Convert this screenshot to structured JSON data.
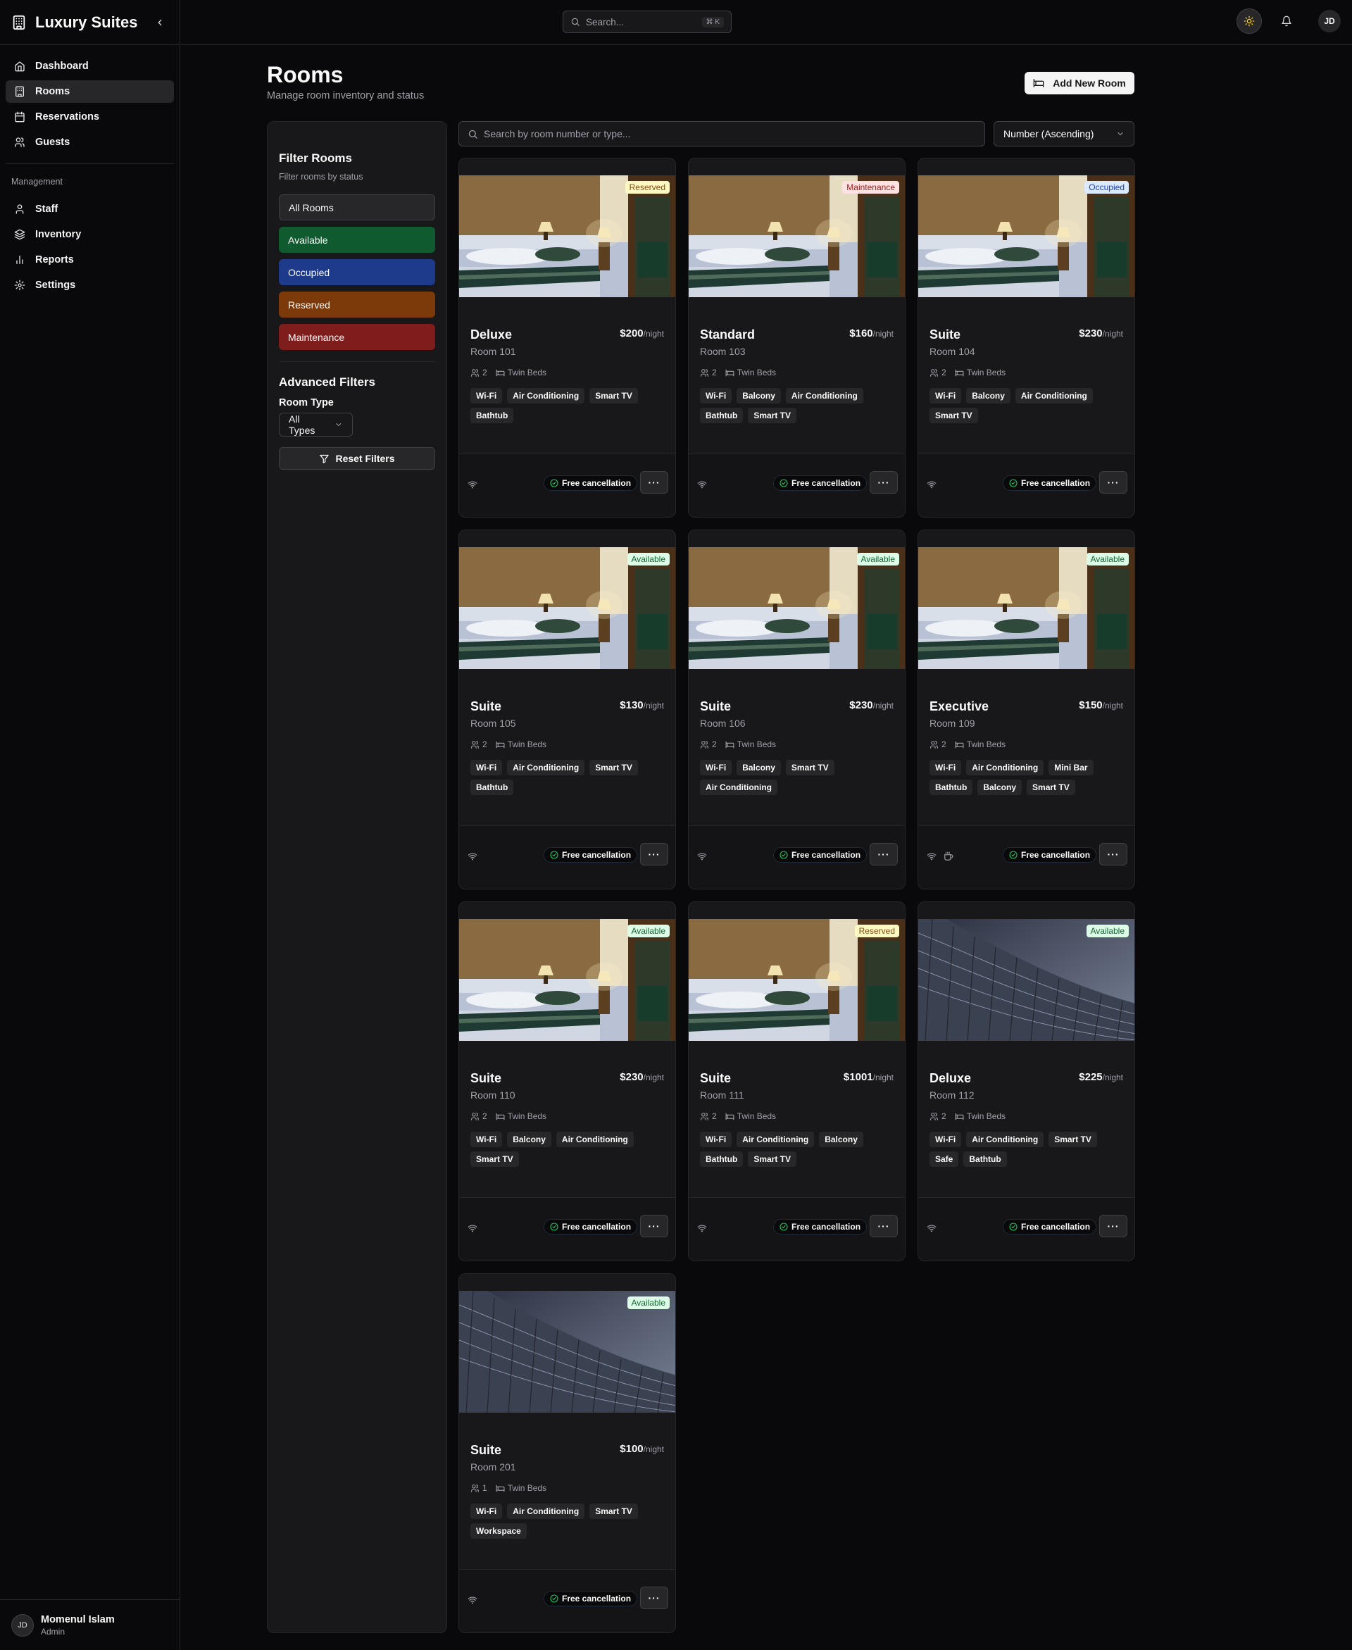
{
  "app": {
    "name": "Luxury Suites"
  },
  "sidebar": {
    "items": [
      {
        "label": "Dashboard",
        "icon": "home-icon",
        "active": false
      },
      {
        "label": "Rooms",
        "icon": "building-icon",
        "active": true
      },
      {
        "label": "Reservations",
        "icon": "calendar-icon",
        "active": false
      },
      {
        "label": "Guests",
        "icon": "users-icon",
        "active": false
      }
    ],
    "group_label": "Management",
    "mgmt_items": [
      {
        "label": "Staff",
        "icon": "user-icon"
      },
      {
        "label": "Inventory",
        "icon": "layers-icon"
      },
      {
        "label": "Reports",
        "icon": "bar-chart-icon"
      },
      {
        "label": "Settings",
        "icon": "gear-icon"
      }
    ],
    "user": {
      "initials": "JD",
      "name": "Momenul Islam",
      "role": "Admin"
    }
  },
  "topbar": {
    "search_placeholder": "Search...",
    "shortcut": "⌘ K",
    "avatar": "JD"
  },
  "page": {
    "title": "Rooms",
    "subtitle": "Manage room inventory and status",
    "add_button": "Add New Room"
  },
  "filters": {
    "title": "Filter Rooms",
    "subtitle": "Filter rooms by status",
    "status_buttons": [
      {
        "label": "All Rooms",
        "color": "#27272a"
      },
      {
        "label": "Available",
        "color": "#0f5a2e"
      },
      {
        "label": "Occupied",
        "color": "#1e3a8a"
      },
      {
        "label": "Reserved",
        "color": "#7c3a0b"
      },
      {
        "label": "Maintenance",
        "color": "#7f1d1d"
      }
    ],
    "advanced_title": "Advanced Filters",
    "room_type_label": "Room Type",
    "room_type_value": "All Types",
    "reset_label": "Reset Filters"
  },
  "search": {
    "placeholder": "Search by room number or type..."
  },
  "sort": {
    "value": "Number (Ascending)"
  },
  "common": {
    "per_night": "/night",
    "beds": "Twin Beds",
    "free_cancel": "Free cancellation",
    "more": "···"
  },
  "rooms": [
    {
      "type": "Deluxe",
      "room": "Room 101",
      "price": "$200",
      "guests": "2",
      "status": "Reserved",
      "image": "bedroom",
      "amenities": [
        "Wi-Fi",
        "Air Conditioning",
        "Smart TV",
        "Bathtub"
      ],
      "extra_icons": [
        "wifi-icon"
      ]
    },
    {
      "type": "Standard",
      "room": "Room 103",
      "price": "$160",
      "guests": "2",
      "status": "Maintenance",
      "image": "bedroom",
      "amenities": [
        "Wi-Fi",
        "Balcony",
        "Air Conditioning",
        "Bathtub",
        "Smart TV"
      ],
      "extra_icons": [
        "wifi-icon"
      ]
    },
    {
      "type": "Suite",
      "room": "Room 104",
      "price": "$230",
      "guests": "2",
      "status": "Occupied",
      "image": "bedroom",
      "amenities": [
        "Wi-Fi",
        "Balcony",
        "Air Conditioning",
        "Smart TV"
      ],
      "extra_icons": [
        "wifi-icon"
      ]
    },
    {
      "type": "Suite",
      "room": "Room 105",
      "price": "$130",
      "guests": "2",
      "status": "Available",
      "image": "bedroom",
      "amenities": [
        "Wi-Fi",
        "Air Conditioning",
        "Smart TV",
        "Bathtub"
      ],
      "extra_icons": [
        "wifi-icon"
      ]
    },
    {
      "type": "Suite",
      "room": "Room 106",
      "price": "$230",
      "guests": "2",
      "status": "Available",
      "image": "bedroom",
      "amenities": [
        "Wi-Fi",
        "Balcony",
        "Smart TV",
        "Air Conditioning"
      ],
      "extra_icons": [
        "wifi-icon"
      ]
    },
    {
      "type": "Executive",
      "room": "Room 109",
      "price": "$150",
      "guests": "2",
      "status": "Available",
      "image": "bedroom",
      "amenities": [
        "Wi-Fi",
        "Air Conditioning",
        "Mini Bar",
        "Bathtub",
        "Balcony",
        "Smart TV"
      ],
      "extra_icons": [
        "wifi-icon",
        "coffee-icon"
      ]
    },
    {
      "type": "Suite",
      "room": "Room 110",
      "price": "$230",
      "guests": "2",
      "status": "Available",
      "image": "bedroom",
      "amenities": [
        "Wi-Fi",
        "Balcony",
        "Air Conditioning",
        "Smart TV"
      ],
      "extra_icons": [
        "wifi-icon"
      ]
    },
    {
      "type": "Suite",
      "room": "Room 111",
      "price": "$1001",
      "guests": "2",
      "status": "Reserved",
      "image": "bedroom",
      "amenities": [
        "Wi-Fi",
        "Air Conditioning",
        "Balcony",
        "Bathtub",
        "Smart TV"
      ],
      "extra_icons": [
        "wifi-icon"
      ]
    },
    {
      "type": "Deluxe",
      "room": "Room 112",
      "price": "$225",
      "guests": "2",
      "status": "Available",
      "image": "building",
      "amenities": [
        "Wi-Fi",
        "Air Conditioning",
        "Smart TV",
        "Safe",
        "Bathtub"
      ],
      "extra_icons": [
        "wifi-icon"
      ]
    },
    {
      "type": "Suite",
      "room": "Room 201",
      "price": "$100",
      "guests": "1",
      "status": "Available",
      "image": "building",
      "amenities": [
        "Wi-Fi",
        "Air Conditioning",
        "Smart TV",
        "Workspace"
      ],
      "extra_icons": [
        "wifi-icon"
      ]
    }
  ]
}
